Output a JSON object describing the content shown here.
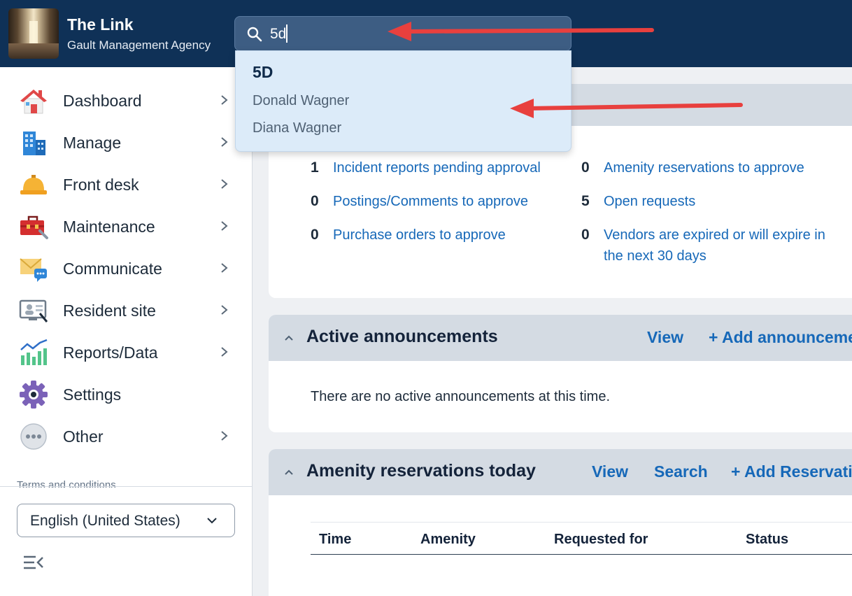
{
  "header": {
    "app_title": "The Link",
    "app_subtitle": "Gault Management Agency",
    "search_value": "5d",
    "colors": {
      "header_bg": "#0f3157",
      "search_bg": "#3d5d83",
      "link": "#1668b8",
      "annotation_arrow": "#e8403e"
    }
  },
  "search_dropdown": {
    "group_label": "5D",
    "results": [
      "Donald Wagner",
      "Diana Wagner"
    ]
  },
  "sidebar": {
    "items": [
      {
        "label": "Dashboard",
        "icon": "house-icon",
        "has_chevron": true
      },
      {
        "label": "Manage",
        "icon": "building-icon",
        "has_chevron": true
      },
      {
        "label": "Front desk",
        "icon": "bell-icon",
        "has_chevron": true
      },
      {
        "label": "Maintenance",
        "icon": "toolbox-icon",
        "has_chevron": true
      },
      {
        "label": "Communicate",
        "icon": "envelope-chat-icon",
        "has_chevron": true
      },
      {
        "label": "Resident site",
        "icon": "monitor-icon",
        "has_chevron": true
      },
      {
        "label": "Reports/Data",
        "icon": "chart-icon",
        "has_chevron": true
      },
      {
        "label": "Settings",
        "icon": "gear-icon",
        "has_chevron": false
      },
      {
        "label": "Other",
        "icon": "more-icon",
        "has_chevron": true
      }
    ],
    "terms_label": "Terms and conditions",
    "language": "English (United States)"
  },
  "tasks_card": {
    "stats": [
      {
        "count": "1",
        "label": "Incident reports pending approval"
      },
      {
        "count": "0",
        "label": "Postings/Comments to approve"
      },
      {
        "count": "0",
        "label": "Purchase orders to approve"
      },
      {
        "count": "0",
        "label": "Amenity reservations to approve"
      },
      {
        "count": "5",
        "label": "Open requests"
      },
      {
        "count": "0",
        "label": "Vendors are expired or will expire in the next 30 days"
      }
    ]
  },
  "announcements_card": {
    "title": "Active announcements",
    "view_label": "View",
    "add_label": "+ Add announcement",
    "empty_message": "There are no active announcements at this time."
  },
  "amenity_card": {
    "title": "Amenity reservations today",
    "view_label": "View",
    "search_label": "Search",
    "add_label": "+ Add Reservation",
    "columns": [
      "Time",
      "Amenity",
      "Requested for",
      "Status"
    ]
  }
}
